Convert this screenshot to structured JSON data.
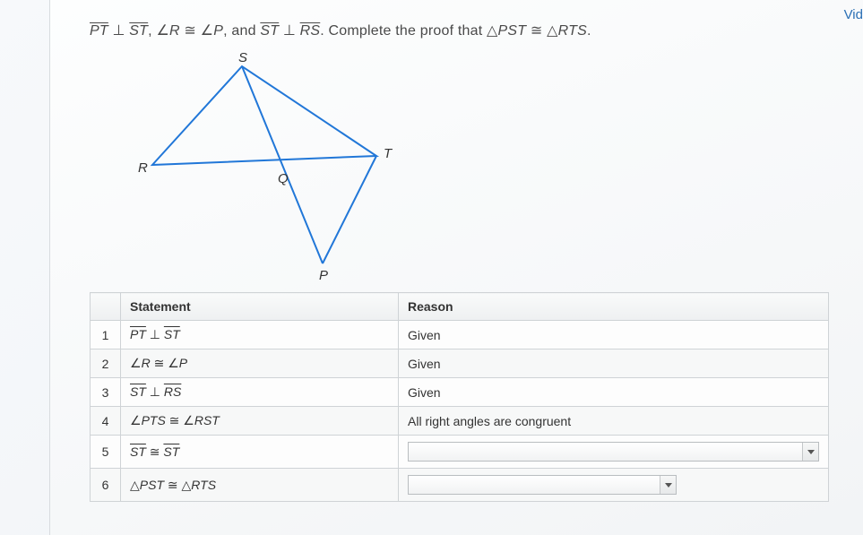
{
  "topRight": "Vid",
  "prompt": {
    "seg1": "PT",
    "perp1": " ⊥ ",
    "seg2": "ST",
    "comma1": ", ∠",
    "angR": "R",
    "cong1": " ≅ ∠",
    "angP": "P",
    "mid": ", and ",
    "seg3": "ST",
    "perp2": " ⊥ ",
    "seg4": "RS",
    "tail1": ". Complete the proof that △",
    "tri1": "PST",
    "cong2": " ≅ △",
    "tri2": "RTS",
    "dot": "."
  },
  "labels": {
    "S": "S",
    "T": "T",
    "R": "R",
    "Q": "Q",
    "P": "P"
  },
  "headers": {
    "statement": "Statement",
    "reason": "Reason"
  },
  "rows": [
    {
      "n": "1",
      "stmt": {
        "type": "perp",
        "a": "PT",
        "b": "ST"
      },
      "reason": "Given"
    },
    {
      "n": "2",
      "stmt": {
        "type": "angcong",
        "a": "R",
        "b": "P"
      },
      "reason": "Given"
    },
    {
      "n": "3",
      "stmt": {
        "type": "perp",
        "a": "ST",
        "b": "RS"
      },
      "reason": "Given"
    },
    {
      "n": "4",
      "stmt": {
        "type": "angcong",
        "a": "PTS",
        "b": "RST"
      },
      "reason": "All right angles are congruent"
    },
    {
      "n": "5",
      "stmt": {
        "type": "segcong",
        "a": "ST",
        "b": "ST"
      },
      "reason": null
    },
    {
      "n": "6",
      "stmt": {
        "type": "tricong",
        "a": "PST",
        "b": "RTS"
      },
      "reason": null
    }
  ],
  "selectWidths": {
    "5": "wide",
    "6": "narrow"
  }
}
